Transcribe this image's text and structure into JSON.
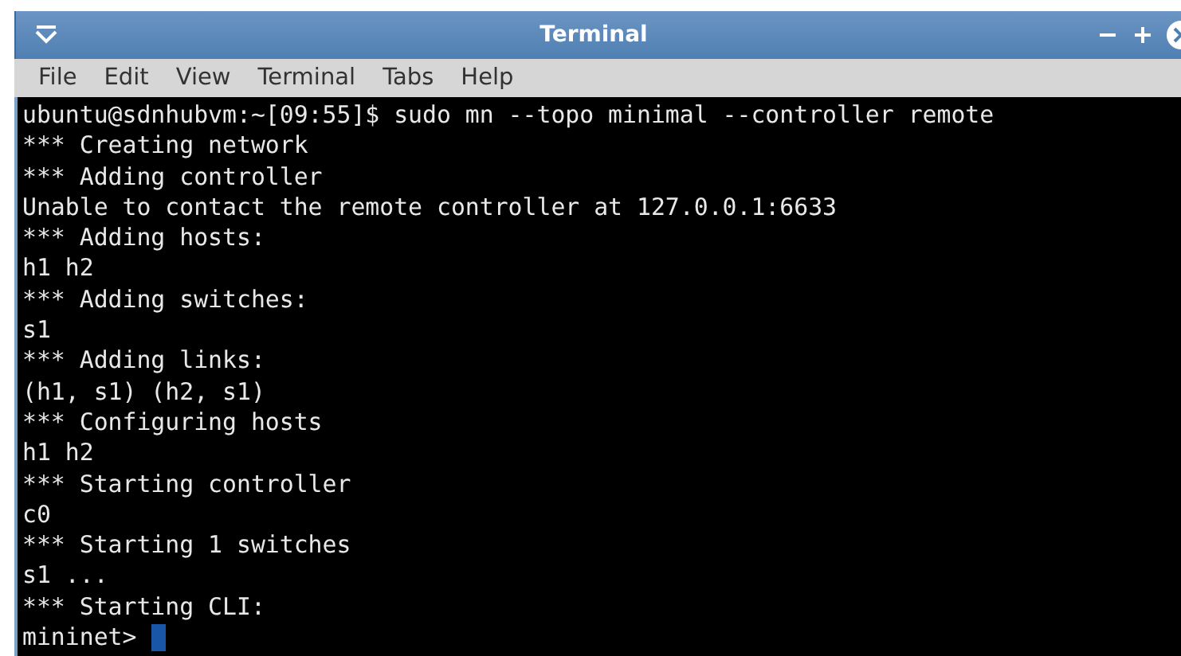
{
  "window": {
    "title": "Terminal"
  },
  "menu": [
    "File",
    "Edit",
    "View",
    "Terminal",
    "Tabs",
    "Help"
  ],
  "terminal": {
    "lines": [
      "ubuntu@sdnhubvm:~[09:55]$ sudo mn --topo minimal --controller remote",
      "*** Creating network",
      "*** Adding controller",
      "Unable to contact the remote controller at 127.0.0.1:6633",
      "*** Adding hosts:",
      "h1 h2",
      "*** Adding switches:",
      "s1",
      "*** Adding links:",
      "(h1, s1) (h2, s1)",
      "*** Configuring hosts",
      "h1 h2",
      "*** Starting controller",
      "c0",
      "*** Starting 1 switches",
      "s1 ...",
      "*** Starting CLI:"
    ],
    "prompt": "mininet> "
  }
}
